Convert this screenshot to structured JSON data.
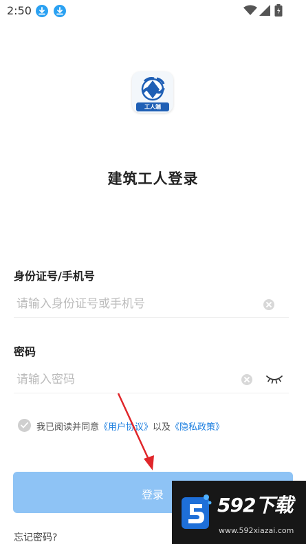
{
  "status_bar": {
    "time": "2:50"
  },
  "logo": {
    "tag_text": "工人端"
  },
  "page": {
    "title": "建筑工人登录"
  },
  "fields": {
    "account": {
      "label": "身份证号/手机号",
      "value": "",
      "placeholder": "请输入身份证号或手机号"
    },
    "password": {
      "label": "密码",
      "value": "",
      "placeholder": "请输入密码"
    }
  },
  "agreement": {
    "prefix": "我已阅读并同意",
    "user_agreement": "《用户协议》",
    "conjunction": "以及",
    "privacy_policy": "《隐私政策》",
    "checked": false
  },
  "login_button": {
    "label": "登录"
  },
  "forgot_password": {
    "label": "忘记密码?"
  },
  "watermark": {
    "title": "592下载",
    "url": "www.592xiazai.com"
  },
  "colors": {
    "accent": "#1d7fe0",
    "login_button": "#8ec3f5",
    "annotation_arrow": "#e0262a"
  }
}
